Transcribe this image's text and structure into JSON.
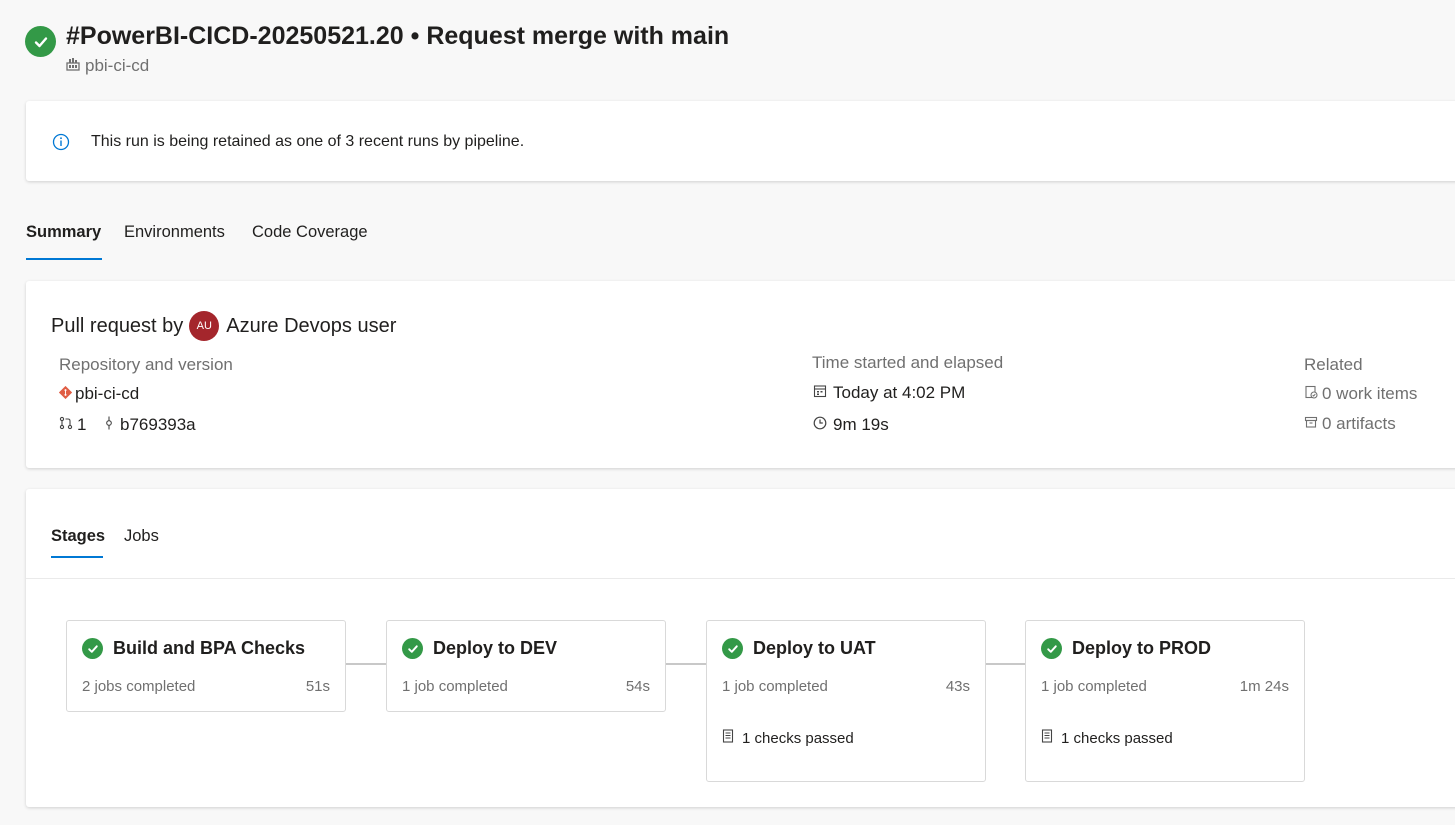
{
  "header": {
    "title": "#PowerBI-CICD-20250521.20 • Request merge with main",
    "pipeline": "pbi-ci-cd"
  },
  "banner": {
    "text": "This run is being retained as one of 3 recent runs by pipeline."
  },
  "tabs": [
    {
      "label": "Summary",
      "active": true
    },
    {
      "label": "Environments",
      "active": false
    },
    {
      "label": "Code Coverage",
      "active": false
    }
  ],
  "summary": {
    "pr_prefix": "Pull request by",
    "user_initials": "AU",
    "user_name": "Azure Devops user",
    "repo_label": "Repository and version",
    "repo_name": "pbi-ci-cd",
    "pr_number": "1",
    "commit": "b769393a",
    "time_label": "Time started and elapsed",
    "started": "Today at 4:02 PM",
    "elapsed": "9m 19s",
    "related_label": "Related",
    "work_items": "0 work items",
    "artifacts": "0 artifacts"
  },
  "stage_tabs": [
    {
      "label": "Stages",
      "active": true
    },
    {
      "label": "Jobs",
      "active": false
    }
  ],
  "stages": [
    {
      "name": "Build and BPA Checks",
      "jobs": "2 jobs completed",
      "duration": "51s",
      "checks": ""
    },
    {
      "name": "Deploy to DEV",
      "jobs": "1 job completed",
      "duration": "54s",
      "checks": ""
    },
    {
      "name": "Deploy to UAT",
      "jobs": "1 job completed",
      "duration": "43s",
      "checks": "1 checks passed"
    },
    {
      "name": "Deploy to PROD",
      "jobs": "1 job completed",
      "duration": "1m 24s",
      "checks": "1 checks passed"
    }
  ],
  "colors": {
    "success": "#339947",
    "accent": "#0078d4",
    "avatar": "#a4262c",
    "git": "#e05d44"
  },
  "icons": {
    "status": "check-circle-icon",
    "pipeline": "pipeline-icon",
    "info": "info-icon",
    "repo": "git-repo-icon",
    "pr": "pull-request-icon",
    "commit": "commit-icon",
    "calendar": "calendar-icon",
    "clock": "clock-icon",
    "work_item": "work-item-icon",
    "artifact": "artifact-icon",
    "checks": "checklist-icon"
  }
}
